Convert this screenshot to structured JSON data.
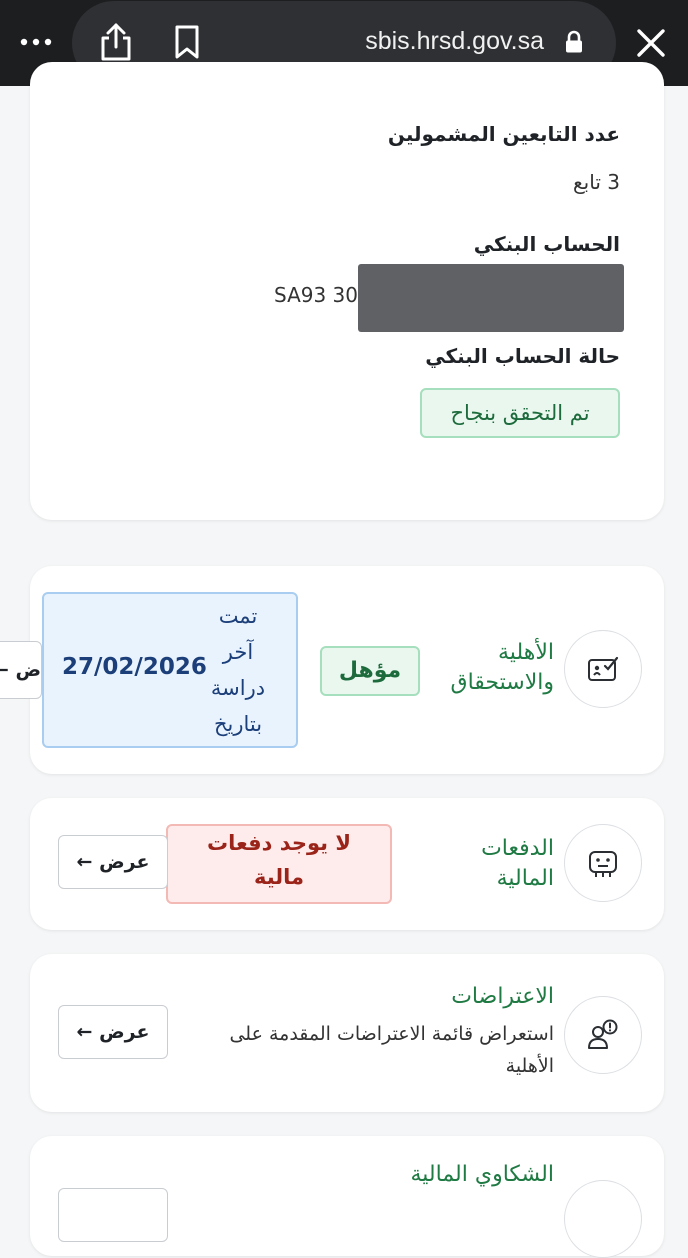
{
  "browser": {
    "url": "sbis.hrsd.gov.sa",
    "icons": [
      "more-icon",
      "share-icon",
      "bookmark-icon",
      "lock-icon",
      "close-icon"
    ]
  },
  "info_card": {
    "dependents_label": "عدد التابعين المشمولين",
    "dependents_value": "3 تابع",
    "bank_account_label": "الحساب البنكي",
    "bank_account_value": "SA93 30",
    "bank_status_label": "حالة الحساب البنكي",
    "bank_status_value": "تم التحقق بنجاح"
  },
  "eligibility_card": {
    "title_line1": "الأهلية",
    "title_line2": "والاستحقاق",
    "status": "مؤهل",
    "last_study_lines": [
      "تمت",
      "آخر",
      "دراسة",
      "بتاريخ"
    ],
    "last_study_date": "27/02/2026",
    "view_button_partial": "ض ←"
  },
  "payments_card": {
    "title_line1": "الدفعات",
    "title_line2": "المالية",
    "status_line1": "لا يوجد دفعات",
    "status_line2": "مالية",
    "view_button": "عرض ←"
  },
  "objections_card": {
    "title": "الاعتراضات",
    "description_line1": "استعراض قائمة الاعتراضات المقدمة على",
    "description_line2": "الأهلية",
    "view_button": "عرض ←"
  },
  "complaints_card": {
    "title": "الشكاوي المالية"
  },
  "colors": {
    "green": "#1f7a43",
    "green_badge_bg": "#e9f7ee",
    "red_badge_bg": "#fdeceb",
    "blue_badge_bg": "#e9f3fd",
    "topbar": "#1d1e20"
  }
}
